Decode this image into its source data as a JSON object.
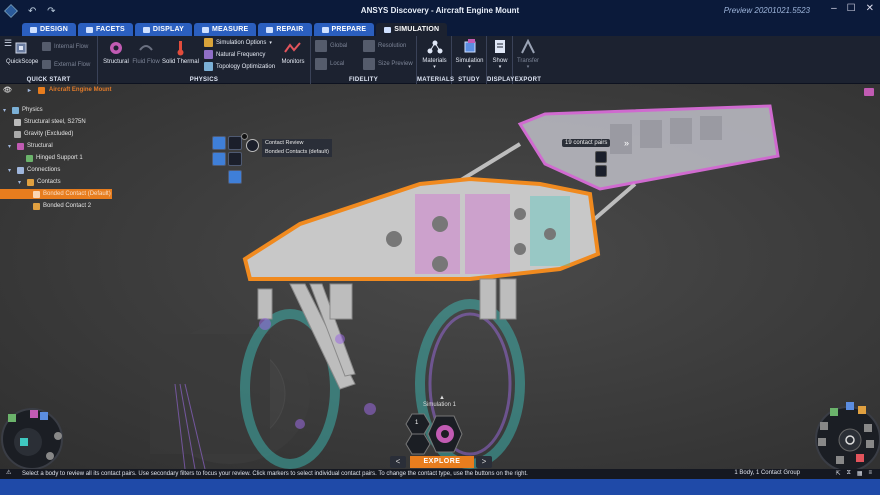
{
  "window": {
    "title": "ANSYS Discovery - Aircraft Engine Mount",
    "version": "Preview 20201021.5523",
    "controls": [
      "–",
      "☐",
      "✕"
    ]
  },
  "tabs": [
    {
      "label": "Design",
      "active": false
    },
    {
      "label": "Facets",
      "active": false
    },
    {
      "label": "Display",
      "active": false
    },
    {
      "label": "Measure",
      "active": false
    },
    {
      "label": "Repair",
      "active": false
    },
    {
      "label": "Prepare",
      "active": false
    },
    {
      "label": "Simulation",
      "active": true
    }
  ],
  "ribbon": {
    "quickstart": {
      "group_label": "QUICK START",
      "quickscope": "QuickScope",
      "internal_flow": "Internal Flow",
      "external_flow": "External Flow"
    },
    "physics": {
      "group_label": "PHYSICS",
      "structural": "Structural",
      "fluid_flow": "Fluid Flow",
      "solid_thermal": "Solid Thermal",
      "simulation_options": "Simulation Options",
      "natural_frequency": "Natural Frequency",
      "topology_optimization": "Topology Optimization",
      "monitors": "Monitors"
    },
    "fidelity": {
      "group_label": "FIDELITY",
      "global": "Global",
      "local": "Local",
      "resolution": "Resolution",
      "size_preview": "Size Preview"
    },
    "materials": {
      "group_label": "MATERIALS",
      "label": "Materials"
    },
    "study": {
      "group_label": "STUDY",
      "label": "Simulation"
    },
    "display": {
      "group_label": "DISPLAY",
      "label": "Show"
    },
    "export": {
      "group_label": "EXPORT",
      "label": "Transfer"
    }
  },
  "tree": {
    "root": "Aircraft Engine Mount",
    "items": [
      {
        "label": "Physics",
        "level": 0
      },
      {
        "label": "Structural steel, S275N",
        "level": 1
      },
      {
        "label": "Gravity    (Excluded)",
        "level": 1
      },
      {
        "label": "Structural",
        "level": 1
      },
      {
        "label": "Hinged Support 1",
        "level": 2
      },
      {
        "label": "Connections",
        "level": 1
      },
      {
        "label": "Contacts",
        "level": 2
      },
      {
        "label": "Bonded Contact (Default)",
        "level": 3,
        "selected": true
      },
      {
        "label": "Bonded Contact 2",
        "level": 3
      }
    ]
  },
  "contact_toolbar": {
    "title": "Contact Review",
    "subtitle": "Bonded Contacts (default)"
  },
  "contact_pairs": {
    "label": "19 contact pairs",
    "arrow": "»"
  },
  "explore": {
    "simulation_label": "Simulation 1",
    "mode_label": "EXPLORE",
    "prev": "<",
    "next": ">",
    "stepper_value": "1"
  },
  "status": {
    "message": "Select a body to review all its contact pairs. Use secondary filters to focus your review. Click markers to select individual contact pairs. To change the contact type, use the buttons on the right.",
    "selection": "1 Body, 1 Contact Group"
  },
  "colors": {
    "accent": "#e87d1e",
    "ribbon": "#1c2230",
    "tab": "#2b5fbf",
    "contact_magenta": "#d25ad2",
    "contact_cyan": "#3fc8c0"
  }
}
